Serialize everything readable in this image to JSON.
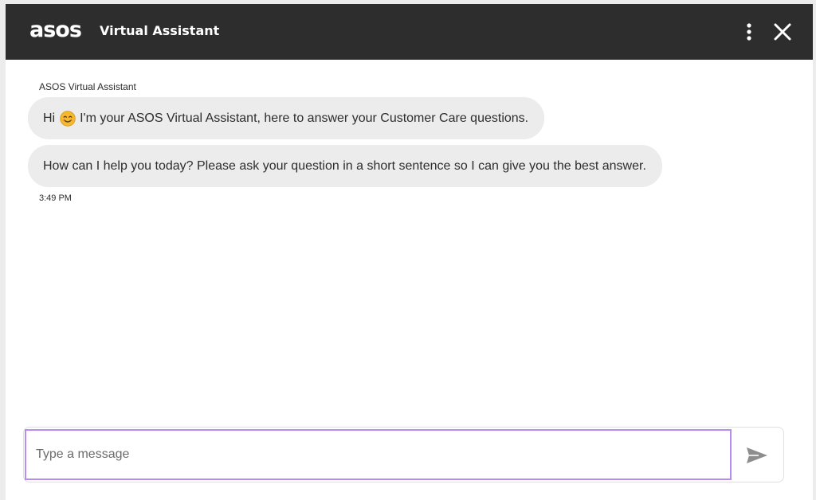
{
  "header": {
    "logo_text": "asos",
    "title": "Virtual Assistant",
    "menu_icon": "more-vertical-icon",
    "close_icon": "close-icon",
    "background_color": "#2d2d2d"
  },
  "conversation": {
    "sender_name": "ASOS Virtual Assistant",
    "messages": [
      {
        "greeting": "Hi",
        "emoji": "smiling-face-icon",
        "text": "I'm your ASOS Virtual Assistant, here to answer your Customer Care questions."
      },
      {
        "text": "How can I help you today? Please ask your question in a short sentence so I can give you the best answer."
      }
    ],
    "timestamp": "3:49 PM",
    "bubble_color": "#ececec"
  },
  "composer": {
    "placeholder": "Type a message",
    "value": "",
    "focus_color": "#b78cf2",
    "send_icon": "send-icon"
  }
}
